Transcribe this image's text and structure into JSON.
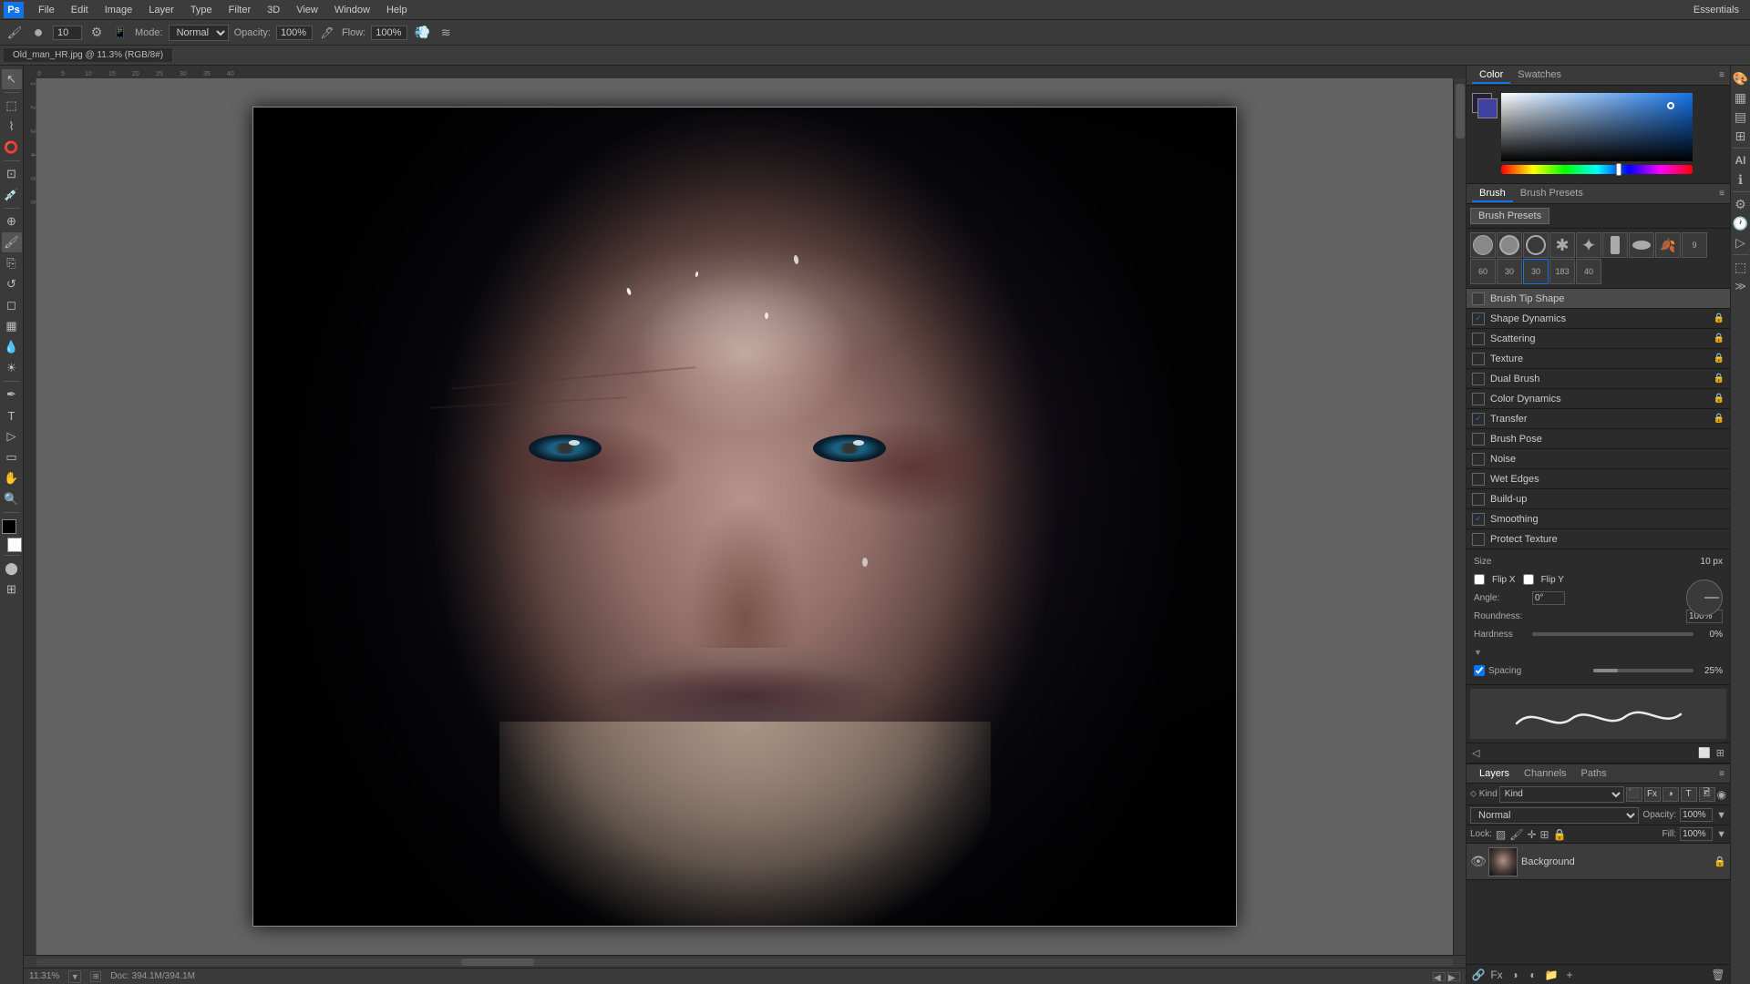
{
  "app": {
    "name": "Adobe Photoshop",
    "logo": "Ps",
    "essentials_label": "Essentials"
  },
  "menubar": {
    "items": [
      "File",
      "Edit",
      "Image",
      "Layer",
      "Type",
      "Filter",
      "3D",
      "View",
      "Window",
      "Help"
    ]
  },
  "optionsbar": {
    "mode_label": "Mode:",
    "mode_value": "Normal",
    "opacity_label": "Opacity:",
    "opacity_value": "100%",
    "flow_label": "Flow:",
    "flow_value": "100%",
    "brush_size": "10"
  },
  "tabbar": {
    "tab": "Old_man_HR.jpg @ 11.3% (RGB/8#)"
  },
  "canvas": {
    "zoom": "11.31%",
    "doc_info": "Doc: 394.1M/394.1M"
  },
  "color_panel": {
    "title": "Color",
    "tabs": [
      "Color",
      "Swatches"
    ],
    "active_tab": "Color"
  },
  "brush_panel": {
    "title": "Brush",
    "presets_tab": "Brush",
    "presets_label": "Brush Presets",
    "preset_button": "Brush Presets",
    "options": [
      {
        "name": "Brush Tip Shape",
        "checked": false,
        "active": true
      },
      {
        "name": "Shape Dynamics",
        "checked": true,
        "active": false
      },
      {
        "name": "Scattering",
        "checked": false,
        "active": false
      },
      {
        "name": "Texture",
        "checked": false,
        "active": false
      },
      {
        "name": "Dual Brush",
        "checked": false,
        "active": false
      },
      {
        "name": "Color Dynamics",
        "checked": false,
        "active": false
      },
      {
        "name": "Transfer",
        "checked": true,
        "active": false
      },
      {
        "name": "Brush Pose",
        "checked": false,
        "active": false
      },
      {
        "name": "Noise",
        "checked": false,
        "active": false
      },
      {
        "name": "Wet Edges",
        "checked": false,
        "active": false
      },
      {
        "name": "Build-up",
        "checked": false,
        "active": false
      },
      {
        "name": "Smoothing",
        "checked": true,
        "active": false
      },
      {
        "name": "Protect Texture",
        "checked": false,
        "active": false
      }
    ],
    "settings": {
      "size_label": "Size",
      "size_value": "10 px",
      "flip_x": "Flip X",
      "flip_y": "Flip Y",
      "angle_label": "Angle:",
      "angle_value": "0°",
      "roundness_label": "Roundness:",
      "roundness_value": "100%",
      "hardness_label": "Hardness",
      "hardness_value": "0%",
      "spacing_label": "Spacing",
      "spacing_value": "25%"
    }
  },
  "layers_panel": {
    "title": "Layers",
    "tabs": [
      "Layers",
      "Channels",
      "Paths"
    ],
    "active_tab": "Layers",
    "blend_mode": "Normal",
    "opacity_label": "Opacity:",
    "opacity_value": "100%",
    "fill_label": "Fill:",
    "fill_value": "100%",
    "lock_label": "Lock:",
    "layers": [
      {
        "name": "Background",
        "visible": true,
        "locked": true
      }
    ]
  },
  "statusbar": {
    "zoom": "11.31%",
    "doc": "Doc: 394.1M/394.1M"
  }
}
